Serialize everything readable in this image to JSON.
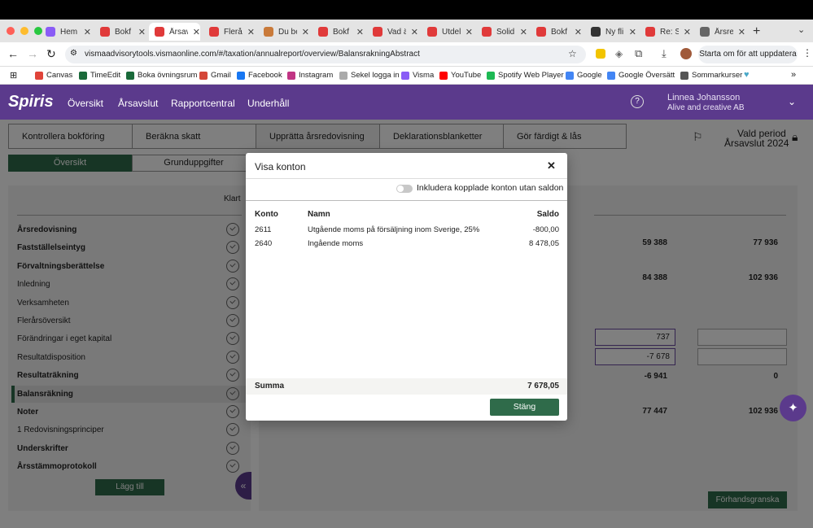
{
  "browser": {
    "tabs": [
      {
        "title": "Hem",
        "icon": "visma-icon",
        "color": "#8a5cf6",
        "active": false
      },
      {
        "title": "Bokf",
        "icon": "spiris-icon",
        "color": "#e03a3a",
        "active": false
      },
      {
        "title": "Årsav",
        "icon": "spiris-icon",
        "color": "#e03a3a",
        "active": true
      },
      {
        "title": "Flerå",
        "icon": "spiris-icon",
        "color": "#e03a3a",
        "active": false
      },
      {
        "title": "Du be",
        "icon": "cookie-icon",
        "color": "#c97a3a",
        "active": false
      },
      {
        "title": "Bokf",
        "icon": "spiris-icon",
        "color": "#e03a3a",
        "active": false
      },
      {
        "title": "Vad ä",
        "icon": "spiris-icon",
        "color": "#e03a3a",
        "active": false
      },
      {
        "title": "Utdel",
        "icon": "spiris-icon",
        "color": "#e03a3a",
        "active": false
      },
      {
        "title": "Solid",
        "icon": "spiris-icon",
        "color": "#e03a3a",
        "active": false
      },
      {
        "title": "Bokf",
        "icon": "spiris-icon",
        "color": "#e03a3a",
        "active": false
      },
      {
        "title": "Ny fli",
        "icon": "github-icon",
        "color": "#333333",
        "active": false
      },
      {
        "title": "Re: S",
        "icon": "spiris-icon",
        "color": "#e03a3a",
        "active": false
      },
      {
        "title": "Årsre",
        "icon": "globe-icon",
        "color": "#666666",
        "active": false
      }
    ],
    "url": "vismaadvisorytools.vismaonline.com/#/taxation/annualreport/overview/BalansrakningAbstract",
    "update_button": "Starta om för att uppdatera",
    "bookmarks": [
      {
        "label": "Canvas",
        "color": "#e0443a"
      },
      {
        "label": "TimeEdit",
        "color": "#1a6a3a"
      },
      {
        "label": "Boka övningsrum",
        "color": "#1a6a3a"
      },
      {
        "label": "Gmail",
        "color": "#d44638"
      },
      {
        "label": "Facebook",
        "color": "#1877f2"
      },
      {
        "label": "Instagram",
        "color": "#c13584"
      },
      {
        "label": "Sekel logga in",
        "color": "#aaaaaa"
      },
      {
        "label": "Visma",
        "color": "#8a5cf6"
      },
      {
        "label": "YouTube",
        "color": "#ff0000"
      },
      {
        "label": "Spotify Web Player",
        "color": "#1db954"
      },
      {
        "label": "Google",
        "color": "#4285f4"
      },
      {
        "label": "Google Översätt",
        "color": "#4285f4"
      },
      {
        "label": "Sommarkurser",
        "color": "#555555"
      }
    ]
  },
  "app": {
    "logo": "Spiris",
    "nav": [
      "Översikt",
      "Årsavslut",
      "Rapportcentral",
      "Underhåll"
    ],
    "user_name": "Linnea Johansson",
    "company": "Alive and creative AB",
    "steps": [
      "Kontrollera bokföring",
      "Beräkna skatt",
      "Upprätta årsredovisning",
      "Deklarationsblanketter",
      "Gör färdigt & lås"
    ],
    "period_label": "Vald period",
    "period_value": "Årsavslut 2024",
    "subtabs": [
      "Översikt",
      "Grunduppgifter"
    ],
    "left_header": "Klart",
    "left_items": [
      {
        "label": "Årsredovisning",
        "bold": true
      },
      {
        "label": "Fastställelseintyg",
        "bold": true
      },
      {
        "label": "Förvaltningsberättelse",
        "bold": true
      },
      {
        "label": "Inledning",
        "bold": false
      },
      {
        "label": "Verksamheten",
        "bold": false
      },
      {
        "label": "Flerårsöversikt",
        "bold": false
      },
      {
        "label": "Förändringar i eget kapital",
        "bold": false
      },
      {
        "label": "Resultatdisposition",
        "bold": false
      },
      {
        "label": "Resultaträkning",
        "bold": true
      },
      {
        "label": "Balansräkning",
        "bold": true,
        "selected": true
      },
      {
        "label": "Noter",
        "bold": true
      },
      {
        "label": "1 Redovisningsprinciper",
        "bold": false
      },
      {
        "label": "Underskrifter",
        "bold": true
      },
      {
        "label": "Årsstämmoprotokoll",
        "bold": true
      }
    ],
    "add_button": "Lägg till",
    "preview_button": "Förhandsgranska",
    "values": {
      "r1a": "59 388",
      "r1b": "77 936",
      "r2a": "84 388",
      "r2b": "102 936",
      "in1": "737",
      "in2": "-7 678",
      "r3a": "-6 941",
      "r3b": "0",
      "r4a": "77 447",
      "r4b": "102 936"
    }
  },
  "modal": {
    "title": "Visa konton",
    "toggle_label": "Inkludera kopplade konton utan saldon",
    "headers": {
      "konto": "Konto",
      "namn": "Namn",
      "saldo": "Saldo"
    },
    "rows": [
      {
        "konto": "2611",
        "namn": "Utgående moms på försäljning inom Sverige, 25%",
        "saldo": "-800,00"
      },
      {
        "konto": "2640",
        "namn": "Ingående moms",
        "saldo": "8 478,05"
      }
    ],
    "sum_label": "Summa",
    "sum_value": "7 678,05",
    "close_button": "Stäng"
  }
}
